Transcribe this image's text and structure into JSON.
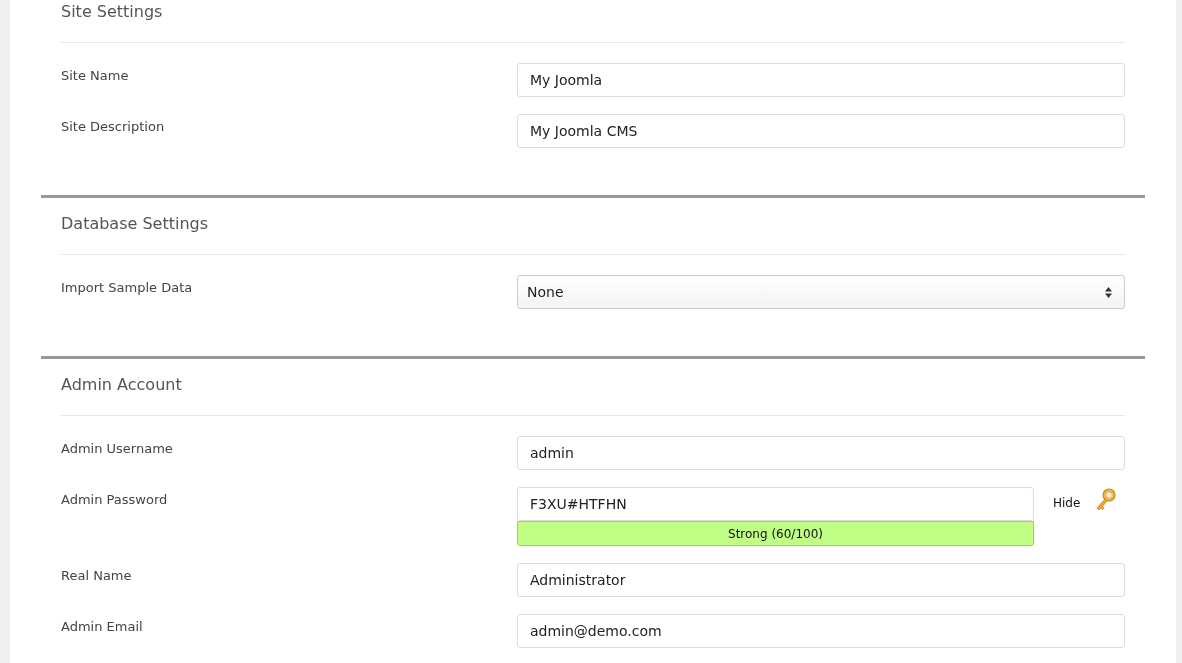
{
  "sections": [
    {
      "title": "Site Settings",
      "fields": [
        {
          "kind": "text",
          "label": "Site Name",
          "value": "My Joomla"
        },
        {
          "kind": "text",
          "label": "Site Description",
          "value": "My Joomla CMS"
        }
      ]
    },
    {
      "title": "Database Settings",
      "fields": [
        {
          "kind": "select",
          "label": "Import Sample Data",
          "value": "None"
        }
      ]
    },
    {
      "title": "Admin Account",
      "fields": [
        {
          "kind": "text",
          "label": "Admin Username",
          "value": "admin"
        },
        {
          "kind": "password",
          "label": "Admin Password",
          "value": "F3XU#HTFHN",
          "strength": "Strong (60/100)",
          "toggle": "Hide"
        },
        {
          "kind": "text",
          "label": "Real Name",
          "value": "Administrator"
        },
        {
          "kind": "text",
          "label": "Admin Email",
          "value": "admin@demo.com"
        }
      ]
    }
  ]
}
